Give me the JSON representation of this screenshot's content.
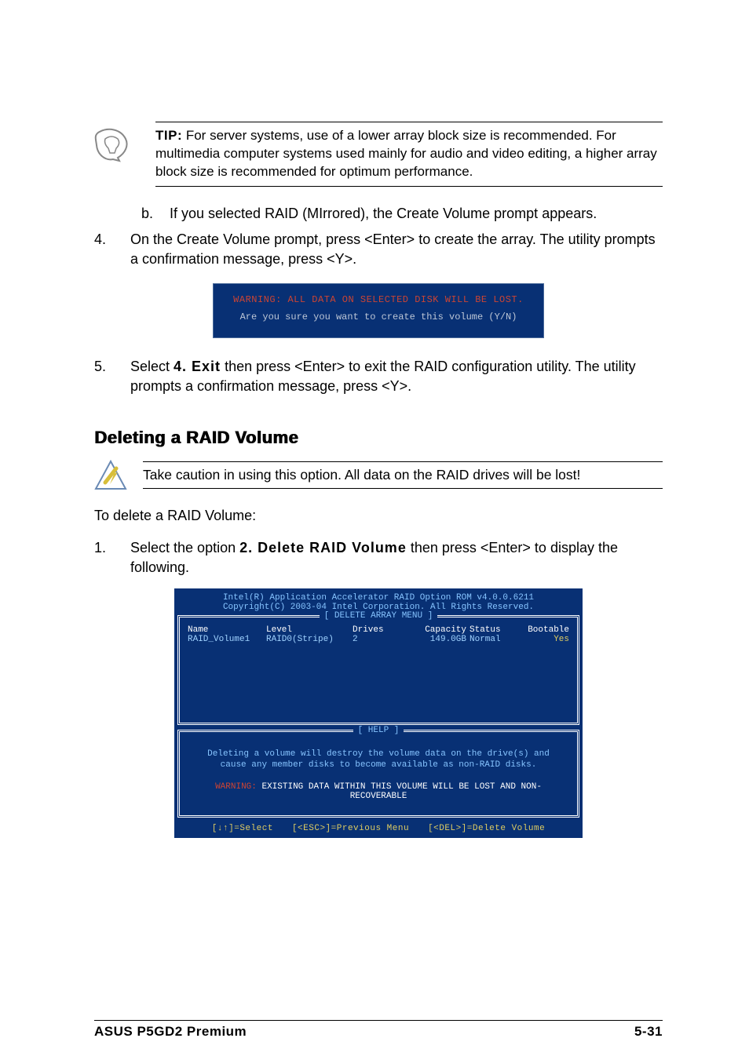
{
  "tip": {
    "label": "TIP:",
    "text": "For server systems, use of a lower array block size is recommended. For multimedia computer systems used mainly for audio and video editing, a higher array block size is recommended for optimum performance."
  },
  "step_b": {
    "marker": "b.",
    "text": "If you selected RAID (MIrrored), the Create Volume prompt appears."
  },
  "step4": {
    "marker": "4.",
    "text": "On the Create Volume prompt, press <Enter> to create the array. The utility prompts a confirmation message, press <Y>."
  },
  "confirm_box": {
    "warn": "WARNING:  ALL DATA ON SELECTED DISK WILL BE LOST.",
    "ask": "Are you sure you want to create this volume (Y/N)"
  },
  "step5": {
    "marker": "5.",
    "pre": "Select ",
    "bold": "4. Exit",
    "post": " then press <Enter> to exit the RAID configuration utility. The utility prompts a confirmation message, press <Y>."
  },
  "section_title": "Deleting a RAID Volume",
  "caution": "Take caution in using this option. All data on the RAID drives will be lost!",
  "delete_intro": "To delete a RAID Volume:",
  "step_d1": {
    "marker": "1.",
    "pre": "Select the option ",
    "bold": "2. Delete RAID Volume",
    "post": " then press <Enter> to display the following."
  },
  "bios": {
    "hdr1": "Intel(R) Application Accelerator RAID Option ROM v4.0.0.6211",
    "hdr2": "Copyright(C) 2003-04 Intel Corporation. All Rights Reserved.",
    "frame_title": "[ DELETE ARRAY MENU ]",
    "cols": {
      "name": "Name",
      "level": "Level",
      "drives": "Drives",
      "cap": "Capacity",
      "status": "Status",
      "boot": "Bootable"
    },
    "row": {
      "name": "RAID_Volume1",
      "level": "RAID0(Stripe)",
      "drives": "2",
      "cap": "149.0GB",
      "status": "Normal",
      "boot": "Yes"
    },
    "help_title": "[ HELP ]",
    "help_line1": "Deleting a volume will destroy the volume data on the drive(s) and",
    "help_line2": "cause any member disks to become available as non-RAID disks.",
    "warn_label": "WARNING:",
    "warn_text": " EXISTING DATA WITHIN THIS VOLUME WILL BE LOST AND NON-RECOVERABLE",
    "keys": {
      "select": "[↓↑]=Select",
      "prev": "[<ESC>]=Previous Menu",
      "del": "[<DEL>]=Delete Volume"
    }
  },
  "footer": {
    "left": "ASUS P5GD2 Premium",
    "right": "5-31"
  }
}
